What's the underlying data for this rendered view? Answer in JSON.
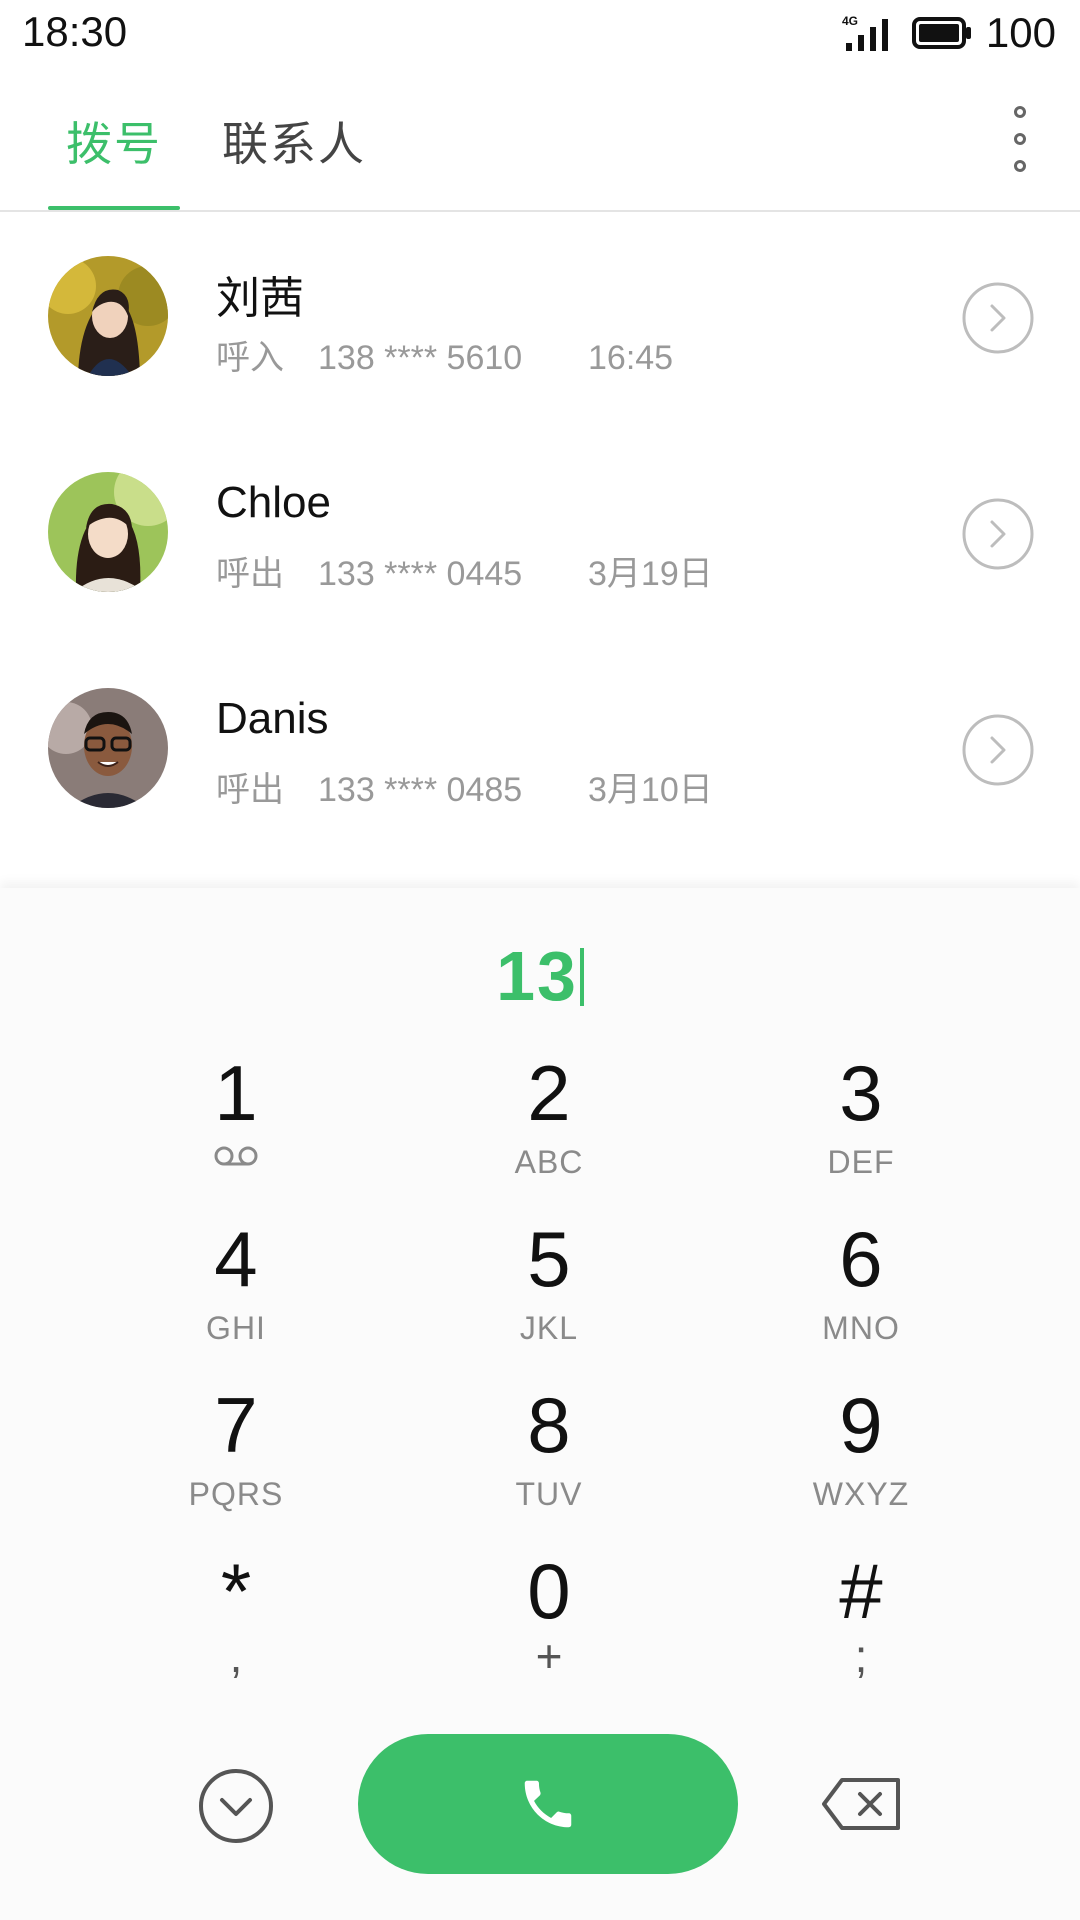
{
  "status_bar": {
    "time": "18:30",
    "network": "4G",
    "battery": "100"
  },
  "tabs": {
    "dial": "拨号",
    "contacts": "联系人",
    "active": "dial"
  },
  "call_log": [
    {
      "name": "刘茜",
      "type": "呼入",
      "number": "138 **** 5610",
      "time": "16:45"
    },
    {
      "name": "Chloe",
      "type": "呼出",
      "number": "133 **** 0445",
      "time": "3月19日"
    },
    {
      "name": "Danis",
      "type": "呼出",
      "number": "133 **** 0485",
      "time": "3月10日"
    }
  ],
  "dialer": {
    "input": "13",
    "keys": [
      {
        "digit": "1",
        "letters": "",
        "voicemail": true
      },
      {
        "digit": "2",
        "letters": "ABC"
      },
      {
        "digit": "3",
        "letters": "DEF"
      },
      {
        "digit": "4",
        "letters": "GHI"
      },
      {
        "digit": "5",
        "letters": "JKL"
      },
      {
        "digit": "6",
        "letters": "MNO"
      },
      {
        "digit": "7",
        "letters": "PQRS"
      },
      {
        "digit": "8",
        "letters": "TUV"
      },
      {
        "digit": "9",
        "letters": "WXYZ"
      },
      {
        "digit": "*",
        "letters": ","
      },
      {
        "digit": "0",
        "letters": "+"
      },
      {
        "digit": "#",
        "letters": ";"
      }
    ]
  },
  "colors": {
    "accent": "#3cbf6a",
    "text_primary": "#111111",
    "text_secondary": "#999999"
  },
  "icons": {
    "more": "more-vertical-icon",
    "detail": "chevron-right-circle-icon",
    "collapse": "chevron-down-circle-icon",
    "call": "phone-icon",
    "delete": "backspace-icon",
    "voicemail": "voicemail-icon"
  }
}
